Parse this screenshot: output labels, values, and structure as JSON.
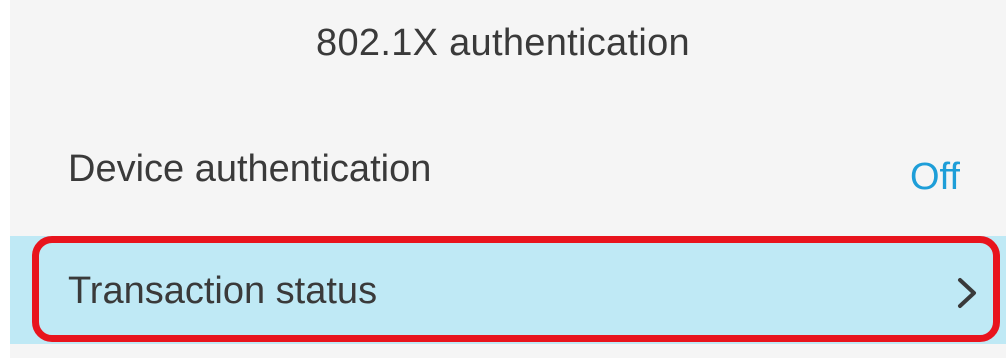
{
  "header": {
    "title": "802.1X authentication"
  },
  "settings": {
    "device_authentication": {
      "label": "Device authentication",
      "value": "Off"
    },
    "transaction_status": {
      "label": "Transaction status",
      "icon": "chevron-right-icon"
    }
  },
  "colors": {
    "value_accent": "#1e9ed8",
    "selected_row": "#bfe9f5",
    "highlight_frame": "#e8141d",
    "panel_background": "#f5f5f5",
    "text": "#3a3a3a"
  }
}
